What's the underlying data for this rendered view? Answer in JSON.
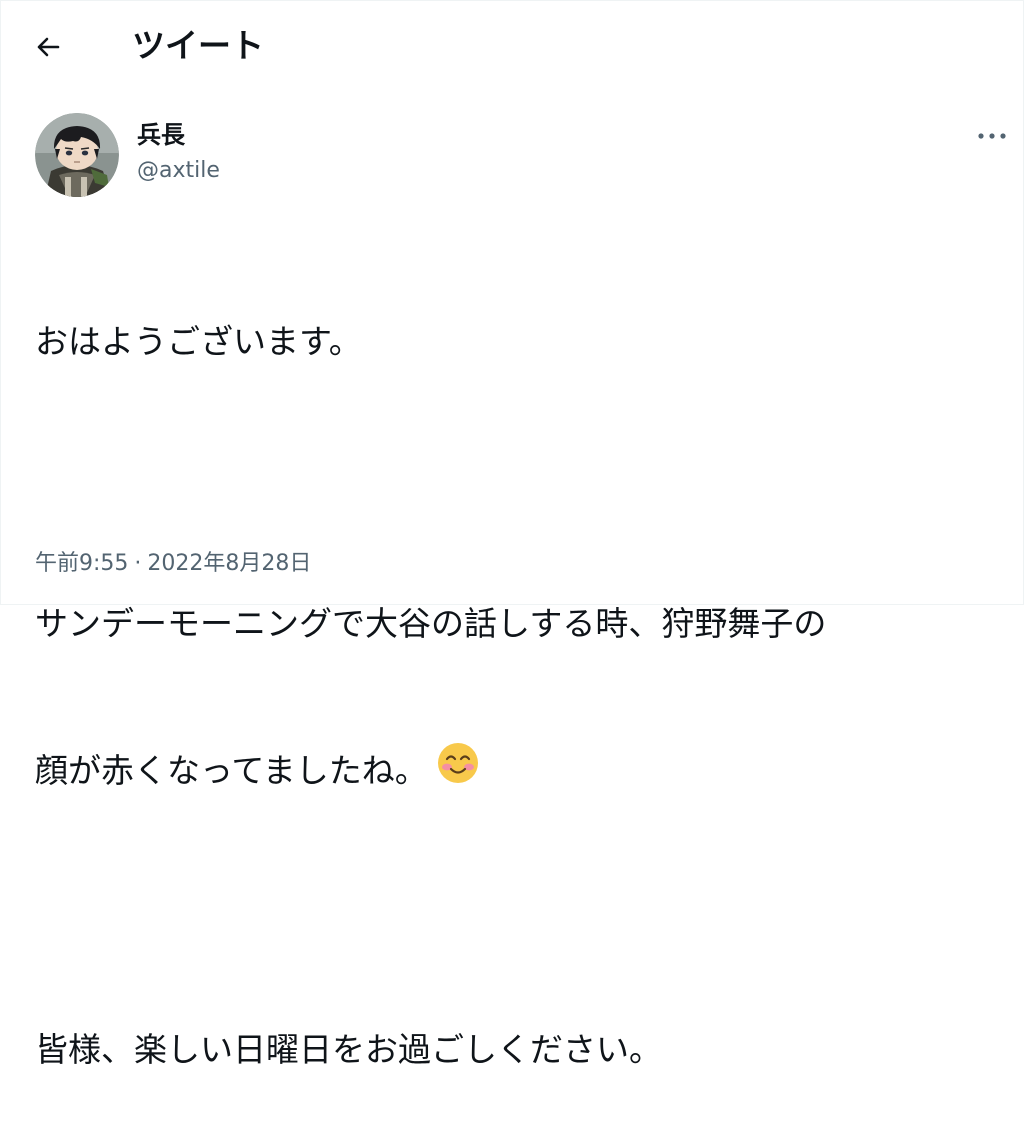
{
  "header": {
    "title": "ツイート",
    "back_icon": "arrow-left-icon"
  },
  "author": {
    "name": "兵長",
    "handle": "@axtile",
    "avatar_icon": "avatar-figure-icon"
  },
  "more_icon": "ellipsis-icon",
  "tweet": {
    "line1": "おはようございます。",
    "line2": "サンデーモーニングで大谷の話しする時、狩野舞子の",
    "line3": "顔が赤くなってましたね。",
    "emoji": "blushing-smile-emoji",
    "line4": "皆様、楽しい日曜日をお過ごしください。"
  },
  "meta": {
    "time": "午前9:55",
    "separator": "·",
    "date": "2022年8月28日"
  },
  "colors": {
    "text": "#0f1419",
    "secondary": "#536471",
    "border": "#eff3f4",
    "emoji_face": "#f8c94b",
    "emoji_blush": "#f58fa3"
  }
}
